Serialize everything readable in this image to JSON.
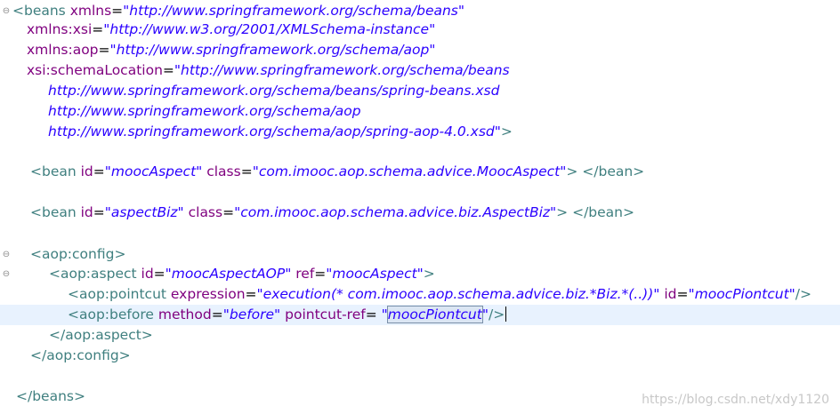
{
  "editor": {
    "lines": [
      {
        "fold": "⊖",
        "tokens": [
          {
            "t": "tag",
            "v": "<beans "
          },
          {
            "t": "attr",
            "v": "xmlns"
          },
          {
            "t": "eq",
            "v": "="
          },
          {
            "t": "val",
            "v": "\"http://www.springframework.org/schema/beans\""
          }
        ]
      },
      {
        "tokens": [
          {
            "t": "attr",
            "v": "xmlns:xsi"
          },
          {
            "t": "eq",
            "v": "="
          },
          {
            "t": "val",
            "v": "\"http://www.w3.org/2001/XMLSchema-instance\""
          }
        ]
      },
      {
        "tokens": [
          {
            "t": "attr",
            "v": "xmlns:aop"
          },
          {
            "t": "eq",
            "v": "="
          },
          {
            "t": "val",
            "v": "\"http://www.springframework.org/schema/aop\""
          }
        ]
      },
      {
        "tokens": [
          {
            "t": "attr",
            "v": "xsi:schemaLocation"
          },
          {
            "t": "eq",
            "v": "="
          },
          {
            "t": "val",
            "v": "\"http://www.springframework.org/schema/beans"
          }
        ]
      },
      {
        "tokens": [
          {
            "t": "val",
            "v": "http://www.springframework.org/schema/beans/spring-beans.xsd"
          }
        ]
      },
      {
        "tokens": [
          {
            "t": "val",
            "v": "http://www.springframework.org/schema/aop"
          }
        ]
      },
      {
        "tokens": [
          {
            "t": "val",
            "v": "http://www.springframework.org/schema/aop/spring-aop-4.0.xsd\""
          },
          {
            "t": "tag",
            "v": ">"
          }
        ]
      },
      {
        "tokens": []
      },
      {
        "tokens": [
          {
            "t": "tag",
            "v": "<bean "
          },
          {
            "t": "attr",
            "v": "id"
          },
          {
            "t": "eq",
            "v": "="
          },
          {
            "t": "val",
            "v": "\"moocAspect\""
          },
          {
            "t": "eq",
            "v": " "
          },
          {
            "t": "attr",
            "v": "class"
          },
          {
            "t": "eq",
            "v": "="
          },
          {
            "t": "val",
            "v": "\"com.imooc.aop.schema.advice.MoocAspect\""
          },
          {
            "t": "tag",
            "v": "> </bean>"
          }
        ]
      },
      {
        "tokens": []
      },
      {
        "tokens": [
          {
            "t": "tag",
            "v": "<bean "
          },
          {
            "t": "attr",
            "v": "id"
          },
          {
            "t": "eq",
            "v": "="
          },
          {
            "t": "val",
            "v": "\"aspectBiz\""
          },
          {
            "t": "eq",
            "v": " "
          },
          {
            "t": "attr",
            "v": "class"
          },
          {
            "t": "eq",
            "v": "="
          },
          {
            "t": "val",
            "v": "\"com.imooc.aop.schema.advice.biz.AspectBiz\""
          },
          {
            "t": "tag",
            "v": "> </bean>"
          }
        ]
      },
      {
        "tokens": []
      },
      {
        "fold": "⊖",
        "tokens": [
          {
            "t": "tag",
            "v": "<aop:config>"
          }
        ]
      },
      {
        "fold": "⊖",
        "tokens": [
          {
            "t": "tag",
            "v": "<aop:aspect "
          },
          {
            "t": "attr",
            "v": "id"
          },
          {
            "t": "eq",
            "v": "="
          },
          {
            "t": "val",
            "v": "\"moocAspectAOP\""
          },
          {
            "t": "eq",
            "v": " "
          },
          {
            "t": "attr",
            "v": "ref"
          },
          {
            "t": "eq",
            "v": "="
          },
          {
            "t": "val",
            "v": "\"moocAspect\""
          },
          {
            "t": "tag",
            "v": ">"
          }
        ]
      },
      {
        "tokens": [
          {
            "t": "tag",
            "v": "<aop:pointcut "
          },
          {
            "t": "attr",
            "v": "expression"
          },
          {
            "t": "eq",
            "v": "="
          },
          {
            "t": "val",
            "v": "\"execution(* com.imooc.aop.schema.advice.biz.*Biz.*(..))\""
          },
          {
            "t": "eq",
            "v": " "
          },
          {
            "t": "attr",
            "v": "id"
          },
          {
            "t": "eq",
            "v": "="
          },
          {
            "t": "val",
            "v": "\"moocPiontcut\""
          },
          {
            "t": "tag",
            "v": "/>"
          }
        ]
      },
      {
        "current": true,
        "tokens": [
          {
            "t": "tag",
            "v": "<aop:before "
          },
          {
            "t": "attr",
            "v": "method"
          },
          {
            "t": "eq",
            "v": "="
          },
          {
            "t": "val",
            "v": "\"before\""
          },
          {
            "t": "eq",
            "v": " "
          },
          {
            "t": "attr",
            "v": "pointcut-ref"
          },
          {
            "t": "eq",
            "v": "= "
          },
          {
            "t": "val",
            "v": "\""
          },
          {
            "t": "sel",
            "v": "moocPiontcut"
          },
          {
            "t": "val",
            "v": "\""
          },
          {
            "t": "tag",
            "v": "/>"
          },
          {
            "t": "caret",
            "v": ""
          }
        ]
      },
      {
        "tokens": [
          {
            "t": "tag",
            "v": "</aop:aspect>"
          }
        ]
      },
      {
        "tokens": [
          {
            "t": "tag",
            "v": "</aop:config>"
          }
        ]
      },
      {
        "tokens": []
      },
      {
        "tokens": [
          {
            "t": "tag",
            "v": "</beans>"
          }
        ]
      }
    ]
  },
  "watermark": "https://blog.csdn.net/xdy1120"
}
